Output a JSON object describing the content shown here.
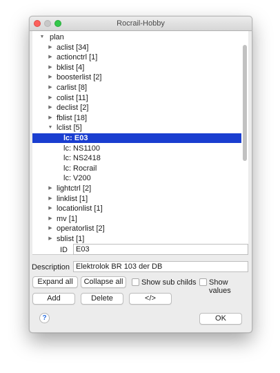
{
  "window": {
    "title": "Rocrail-Hobby"
  },
  "tree": {
    "root": "plan",
    "items": [
      {
        "label": "aclist [34]",
        "kind": "collapsed"
      },
      {
        "label": "actionctrl [1]",
        "kind": "collapsed"
      },
      {
        "label": "bklist [4]",
        "kind": "collapsed"
      },
      {
        "label": "boosterlist [2]",
        "kind": "collapsed"
      },
      {
        "label": "carlist [8]",
        "kind": "collapsed"
      },
      {
        "label": "colist [11]",
        "kind": "collapsed"
      },
      {
        "label": "declist [2]",
        "kind": "collapsed"
      },
      {
        "label": "fblist [18]",
        "kind": "collapsed"
      },
      {
        "label": "lclist [5]",
        "kind": "expanded"
      },
      {
        "label": "lc: E03",
        "kind": "child",
        "selected": true
      },
      {
        "label": "lc: NS1100",
        "kind": "child"
      },
      {
        "label": "lc: NS2418",
        "kind": "child"
      },
      {
        "label": "lc: Rocrail",
        "kind": "child"
      },
      {
        "label": "lc: V200",
        "kind": "child"
      },
      {
        "label": "lightctrl [2]",
        "kind": "collapsed"
      },
      {
        "label": "linklist [1]",
        "kind": "collapsed"
      },
      {
        "label": "locationlist [1]",
        "kind": "collapsed"
      },
      {
        "label": "mv [1]",
        "kind": "collapsed"
      },
      {
        "label": "operatorlist [2]",
        "kind": "collapsed"
      },
      {
        "label": "sblist [1]",
        "kind": "collapsed"
      }
    ]
  },
  "form": {
    "id_label": "ID",
    "id_value": "E03",
    "description_label": "Description",
    "description_value": "Elektrolok BR 103 der DB"
  },
  "buttons": {
    "expand_all": "Expand all",
    "collapse_all": "Collapse all",
    "show_sub_childs": "Show sub childs",
    "show_values": "Show values",
    "add": "Add",
    "delete": "Delete",
    "source": "</>",
    "ok": "OK",
    "help": "?"
  },
  "colors": {
    "selection": "#1a3ed0",
    "close": "#fc605c",
    "maximize": "#34c84a"
  }
}
